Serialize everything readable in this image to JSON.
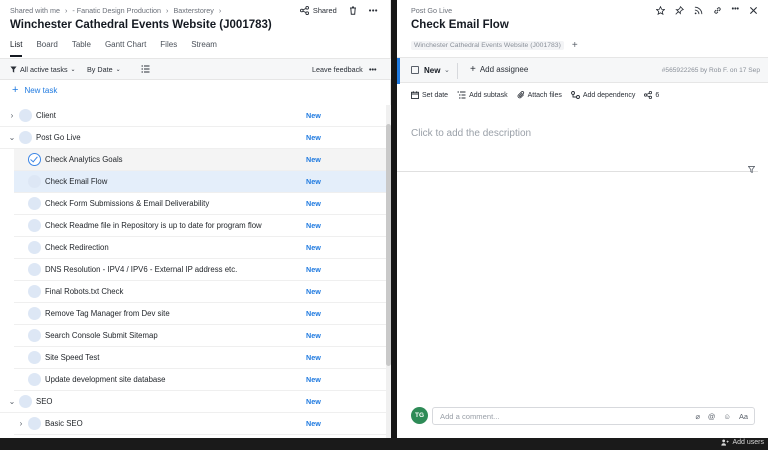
{
  "header": {
    "breadcrumbs": [
      "Shared with me",
      "›",
      "- Fanatic Design Production",
      "›",
      "Baxterstorey",
      "›"
    ],
    "title": "Winchester Cathedral Events Website (J001783)",
    "shared_label": "Shared"
  },
  "tabs": [
    {
      "label": "List",
      "active": true
    },
    {
      "label": "Board",
      "active": false
    },
    {
      "label": "Table",
      "active": false
    },
    {
      "label": "Gantt Chart",
      "active": false
    },
    {
      "label": "Files",
      "active": false
    },
    {
      "label": "Stream",
      "active": false
    }
  ],
  "filters": {
    "active_tasks": "All active tasks",
    "by_date": "By Date",
    "leave_feedback": "Leave feedback"
  },
  "new_task_label": "New task",
  "tasks": [
    {
      "title": "Client",
      "status": "New",
      "level": 0,
      "kind": "folder"
    },
    {
      "title": "Post Go Live",
      "status": "New",
      "level": 0,
      "kind": "folder-open"
    },
    {
      "title": "Check Analytics Goals",
      "status": "New",
      "level": 1,
      "kind": "done"
    },
    {
      "title": "Check Email Flow",
      "status": "New",
      "level": 1,
      "kind": "task",
      "selected": true
    },
    {
      "title": "Check Form Submissions & Email Deliverability",
      "status": "New",
      "level": 1,
      "kind": "task"
    },
    {
      "title": "Check Readme file in Repository is up to date for program flow",
      "status": "New",
      "level": 1,
      "kind": "task"
    },
    {
      "title": "Check Redirection",
      "status": "New",
      "level": 1,
      "kind": "task"
    },
    {
      "title": "DNS Resolution - IPV4 / IPV6 - External IP address etc.",
      "status": "New",
      "level": 1,
      "kind": "task"
    },
    {
      "title": "Final Robots.txt Check",
      "status": "New",
      "level": 1,
      "kind": "task"
    },
    {
      "title": "Remove Tag Manager from Dev site",
      "status": "New",
      "level": 1,
      "kind": "task"
    },
    {
      "title": "Search Console Submit Sitemap",
      "status": "New",
      "level": 1,
      "kind": "task"
    },
    {
      "title": "Site Speed Test",
      "status": "New",
      "level": 1,
      "kind": "task"
    },
    {
      "title": "Update development site database",
      "status": "New",
      "level": 1,
      "kind": "task"
    },
    {
      "title": "SEO",
      "status": "New",
      "level": 0,
      "kind": "folder-open"
    },
    {
      "title": "Basic SEO",
      "status": "New",
      "level": 1,
      "kind": "folder"
    }
  ],
  "detail": {
    "breadcrumb": "Post Go Live",
    "title": "Check Email Flow",
    "project_tag": "Winchester Cathedral Events Website (J001783)",
    "status": "New",
    "add_assignee": "Add assignee",
    "meta": "#565922265 by Rob F. on 17 Sep",
    "actions": {
      "set_date": "Set date",
      "add_subtask": "Add subtask",
      "attach_files": "Attach files",
      "add_dependency": "Add dependency",
      "share_count": "6"
    },
    "description_placeholder": "Click to add the description",
    "comment": {
      "avatar_initials": "TG",
      "placeholder": "Add a comment...",
      "format_label": "Aa"
    }
  },
  "footer": {
    "add_users": "Add users"
  },
  "colors": {
    "accent": "#1f7ae0",
    "avatar": "#2e8b57",
    "selected_row": "#e4eefa"
  }
}
